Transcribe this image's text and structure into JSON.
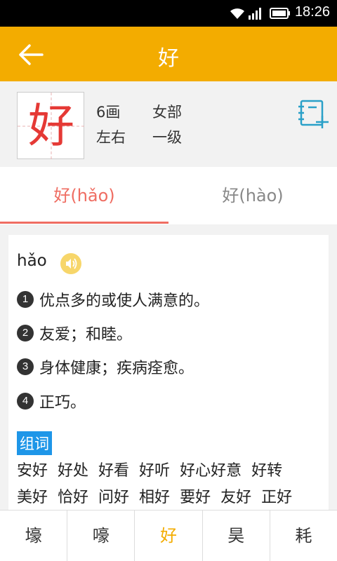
{
  "status_bar": {
    "time": "18:26"
  },
  "app_bar": {
    "title": "好"
  },
  "character": {
    "glyph": "好",
    "strokes": "6画",
    "radical": "女部",
    "structure": "左右",
    "level": "一级"
  },
  "tabs": [
    {
      "label": "好(hǎo)",
      "active": true
    },
    {
      "label": "好(hào)",
      "active": false
    }
  ],
  "entry": {
    "pinyin": "hǎo",
    "definitions": [
      {
        "num": "1",
        "text": "优点多的或使人满意的。"
      },
      {
        "num": "2",
        "text": "友爱；和睦。"
      },
      {
        "num": "3",
        "text": "身体健康；疾病痊愈。"
      },
      {
        "num": "4",
        "text": "正巧。"
      }
    ],
    "words_label": "组词",
    "words": [
      "安好",
      "好处",
      "好看",
      "好听",
      "好心好意",
      "好转",
      "美好",
      "恰好",
      "问好",
      "相好",
      "要好",
      "友好",
      "正好"
    ]
  },
  "bottom_nav": [
    {
      "label": "壕",
      "active": false
    },
    {
      "label": "嚎",
      "active": false
    },
    {
      "label": "好",
      "active": true
    },
    {
      "label": "昊",
      "active": false
    },
    {
      "label": "耗",
      "active": false
    }
  ],
  "colors": {
    "accent": "#f3ac00",
    "active_tab": "#ef6d62",
    "char_red": "#e53935",
    "label_blue": "#1e96e8"
  }
}
